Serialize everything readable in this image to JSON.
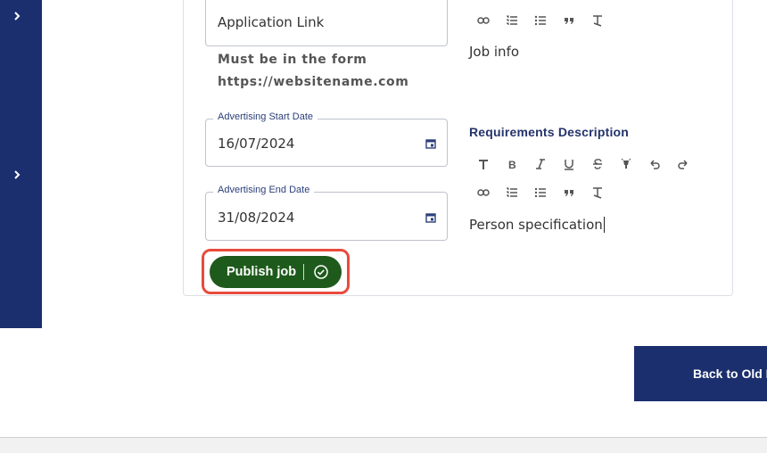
{
  "form": {
    "application_link_placeholder": "Application Link",
    "link_hint_line1": "Must be in the form",
    "link_hint_line2": "https://websitename.com",
    "start_date": {
      "label": "Advertising Start Date",
      "value": "16/07/2024"
    },
    "end_date": {
      "label": "Advertising End Date",
      "value": "31/08/2024"
    },
    "publish_label": "Publish job"
  },
  "editors": {
    "job_info_text": "Job info",
    "requirements_title": "Requirements Description",
    "requirements_text": "Person specification"
  },
  "footer": {
    "back_label": "Back to Old L"
  },
  "colors": {
    "sidebar": "#1b2f6e",
    "publish_green": "#1e5a1b",
    "highlight_red": "#e84b3c",
    "title_navy": "#24336b"
  }
}
